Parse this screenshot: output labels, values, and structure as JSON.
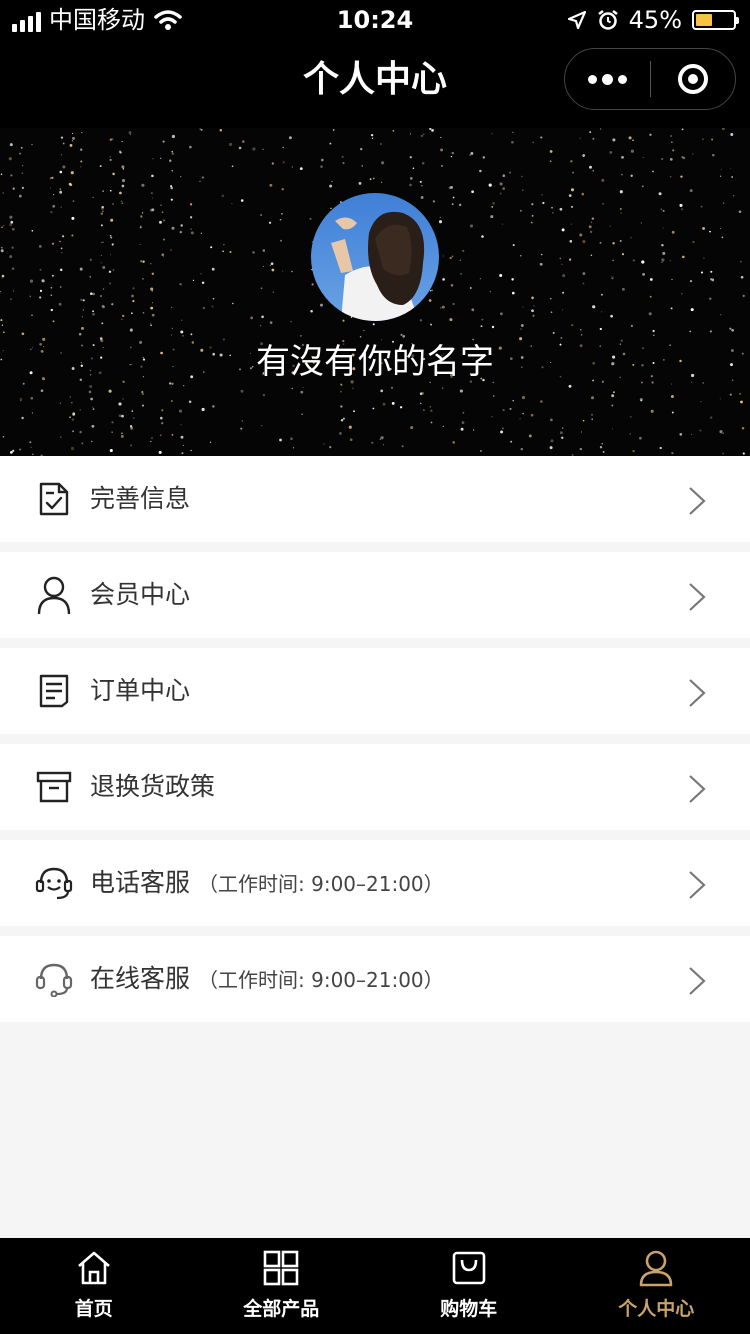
{
  "status_bar": {
    "carrier": "中国移动",
    "time": "10:24",
    "battery": "45%"
  },
  "nav": {
    "title": "个人中心"
  },
  "profile": {
    "username": "有沒有你的名字"
  },
  "menu": [
    {
      "label": "完善信息",
      "icon": "document-check-icon"
    },
    {
      "label": "会员中心",
      "icon": "user-icon"
    },
    {
      "label": "订单中心",
      "icon": "order-list-icon"
    },
    {
      "label": "退换货政策",
      "icon": "box-icon"
    },
    {
      "label": "电话客服",
      "sub": "（工作时间: 9:00–21:00）",
      "icon": "headset-smile-icon"
    },
    {
      "label": "在线客服",
      "sub": "（工作时间: 9:00–21:00）",
      "icon": "headset-icon"
    }
  ],
  "tabbar": [
    {
      "label": "首页",
      "icon": "home-icon",
      "active": false
    },
    {
      "label": "全部产品",
      "icon": "grid-icon",
      "active": false
    },
    {
      "label": "购物车",
      "icon": "shopping-bag-icon",
      "active": false
    },
    {
      "label": "个人中心",
      "icon": "user-icon",
      "active": true
    }
  ],
  "colors": {
    "accent": "#c9a36b",
    "header_bg": "#000000",
    "page_bg": "#f5f5f5"
  }
}
